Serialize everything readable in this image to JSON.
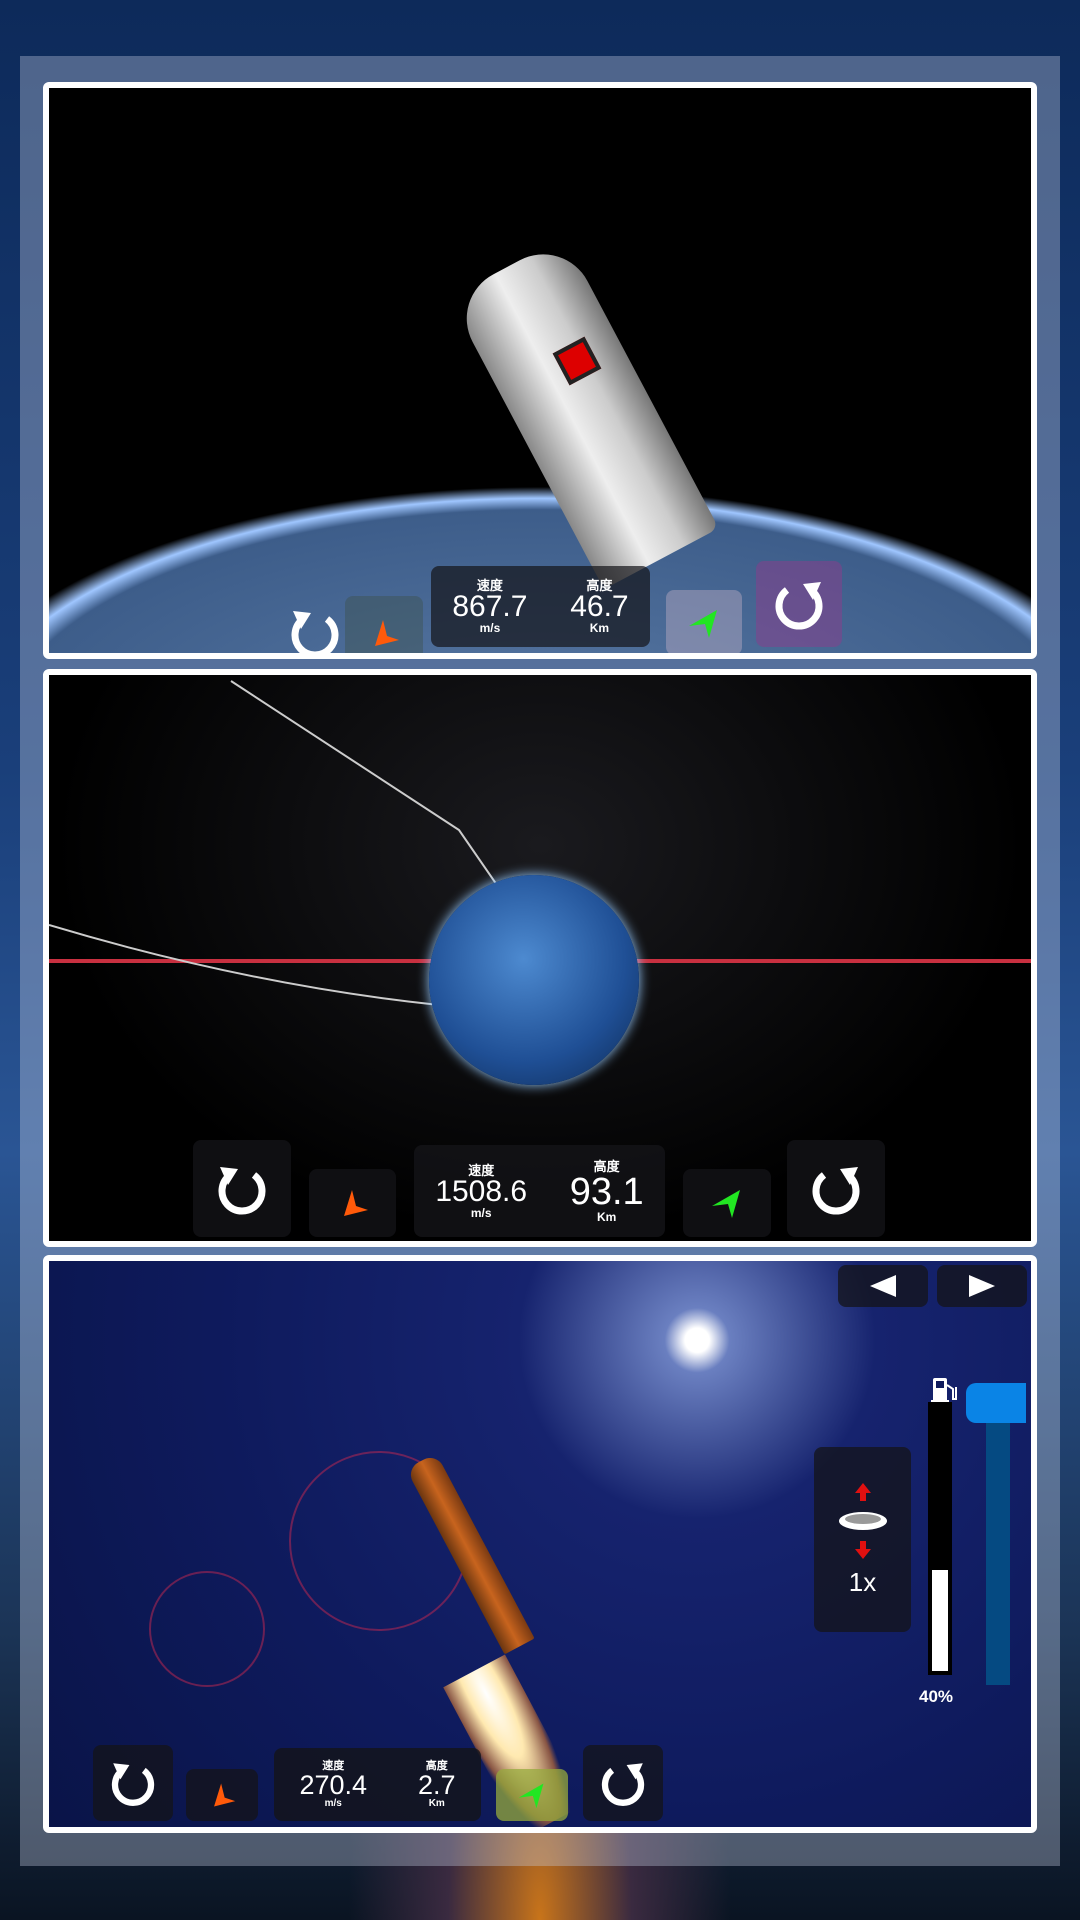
{
  "colors": {
    "accent_blue": "#0a84e6",
    "orange_arrow": "#ff5a0a",
    "green_arrow": "#22e622",
    "zoom_arrow": "#e01010"
  },
  "panels": [
    {
      "speed_label": "速度",
      "speed": "867.7",
      "speed_unit": "m/s",
      "alt_label": "高度",
      "altitude": "46.7",
      "alt_unit": "Km"
    },
    {
      "speed_label": "速度",
      "speed": "1508.6",
      "speed_unit": "m/s",
      "alt_label": "高度",
      "altitude": "93.1",
      "alt_unit": "Km"
    },
    {
      "speed_label": "速度",
      "speed": "270.4",
      "speed_unit": "m/s",
      "alt_label": "高度",
      "altitude": "2.7",
      "alt_unit": "Km"
    }
  ],
  "controls": {
    "zoom_level": "1x",
    "fuel_percent": 40,
    "fuel_label": "40%",
    "prev_icon": "triangle-left",
    "next_icon": "triangle-right"
  }
}
